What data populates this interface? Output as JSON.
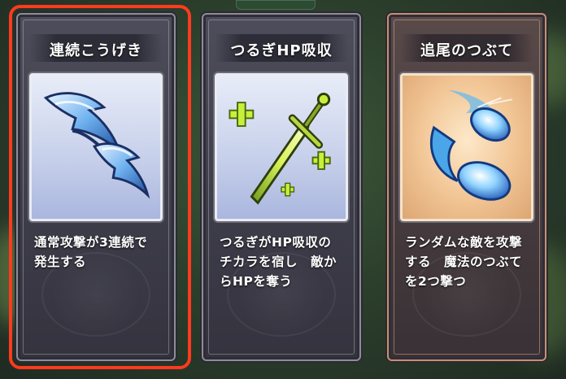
{
  "cards": [
    {
      "title": "連続こうげき",
      "description": "通常攻撃が3連続で\n発生する",
      "icon": "double-arrow-icon",
      "selected": true,
      "theme": "silver"
    },
    {
      "title": "つるぎHP吸収",
      "description": "つるぎがHP吸収の\nチカラを宿し　敵か\nらHPを奪う",
      "icon": "sword-heal-icon",
      "selected": false,
      "theme": "silver"
    },
    {
      "title": "追尾のつぶて",
      "description": "ランダムな敵を攻撃\nする　魔法のつぶて\nを2つ撃つ",
      "icon": "homing-projectile-icon",
      "selected": false,
      "theme": "bronze"
    }
  ],
  "colors": {
    "selection_ring": "#ff3a1e",
    "heal_cross": "#c8ef3a"
  }
}
